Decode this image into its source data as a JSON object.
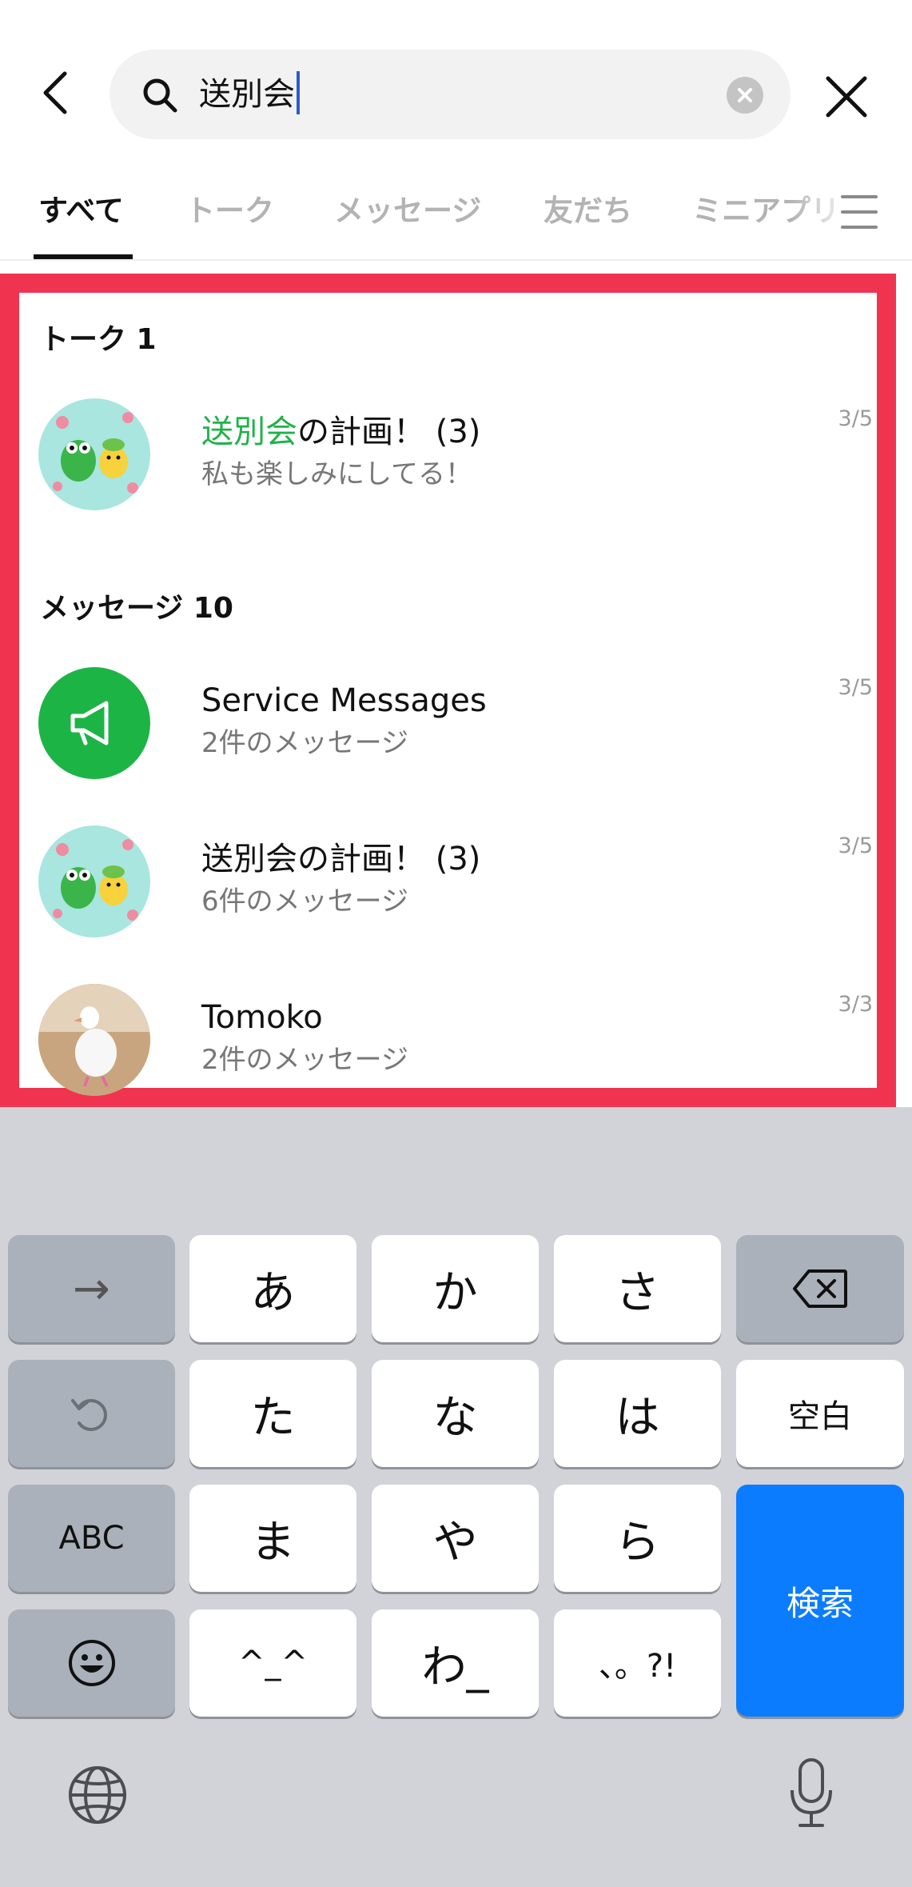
{
  "search": {
    "query": "送別会"
  },
  "tabs": [
    {
      "label": "すべて",
      "active": true
    },
    {
      "label": "トーク",
      "active": false
    },
    {
      "label": "メッセージ",
      "active": false
    },
    {
      "label": "友だち",
      "active": false
    },
    {
      "label": "ミニアプリ",
      "active": false
    }
  ],
  "sections": {
    "talk": {
      "title": "トーク 1",
      "items": [
        {
          "title_highlight": "送別会",
          "title_rest": "の計画！ (3)",
          "subtitle": "私も楽しみにしてる！",
          "date": "3/5",
          "avatar": "sticker-avatar"
        }
      ]
    },
    "messages": {
      "title": "メッセージ 10",
      "items": [
        {
          "title": "Service Messages",
          "subtitle": "2件のメッセージ",
          "date": "3/5",
          "avatar": "megaphone-icon"
        },
        {
          "title": "送別会の計画！ (3)",
          "subtitle": "6件のメッセージ",
          "date": "3/5",
          "avatar": "sticker-avatar"
        },
        {
          "title": "Tomoko",
          "subtitle": "2件のメッセージ",
          "date": "3/3",
          "avatar": "duck-photo-avatar"
        }
      ]
    }
  },
  "keyboard": {
    "rows": [
      [
        "→",
        "あ",
        "か",
        "さ",
        "backspace-icon"
      ],
      [
        "undo-icon",
        "た",
        "な",
        "は",
        "空白"
      ],
      [
        "ABC",
        "ま",
        "や",
        "ら",
        "検索"
      ],
      [
        "emoji-icon",
        "^_^",
        "わ_",
        "、。?!"
      ]
    ],
    "keys": {
      "arrow": "→",
      "a": "あ",
      "ka": "か",
      "sa": "さ",
      "ta": "た",
      "na": "な",
      "ha": "は",
      "space": "空白",
      "abc": "ABC",
      "ma": "ま",
      "ya": "や",
      "ra": "ら",
      "search": "検索",
      "kaomoji": "^_^",
      "wa": "わ_",
      "punct": "、。?!"
    }
  },
  "colors": {
    "highlight": "#20b24a",
    "frame": "#f0344f",
    "search_key": "#0c7cff",
    "megaphone_bg": "#1db446"
  }
}
